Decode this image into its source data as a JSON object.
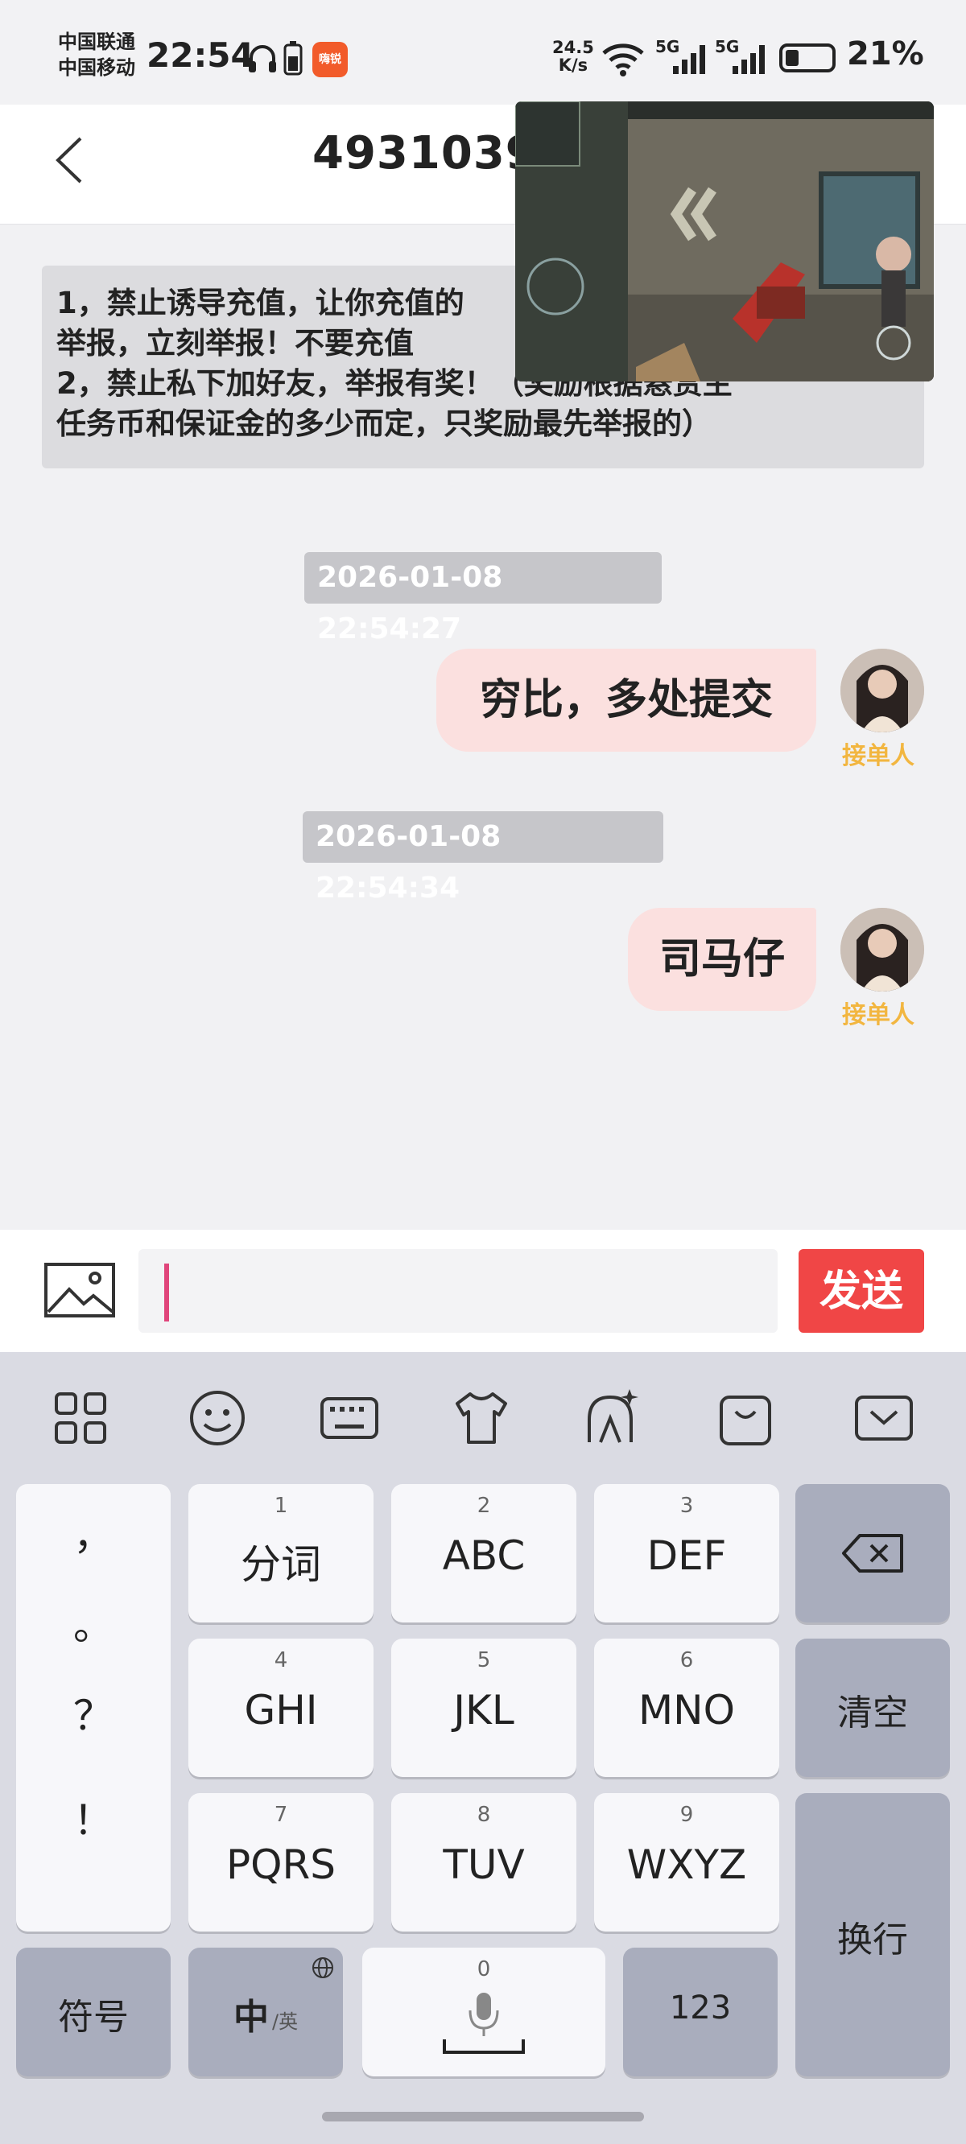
{
  "status": {
    "carrier1": "中国联通",
    "carrier2": "中国移动",
    "time": "22:54",
    "app_badge": "嗨锐",
    "net_speed": "24.5",
    "net_unit": "K/s",
    "sig1": "5G",
    "sig2": "5G",
    "battery": "21%",
    "battery_level": 0.21
  },
  "header": {
    "title": "49310391"
  },
  "notice": {
    "line1": "1，禁止诱导充值，让你充值的",
    "line2": "举报，立刻举报！不要充值",
    "line3": "2，禁止私下加好友，举报有奖！（奖励根据悬赏主",
    "line4": "任务币和保证金的多少而定，只奖励最先举报的）"
  },
  "messages": [
    {
      "time": "2026-01-08 22:54:27",
      "text": "穷比，多处提交",
      "role": "接单人"
    },
    {
      "time": "2026-01-08 22:54:34",
      "text": "司马仔",
      "role": "接单人"
    }
  ],
  "input": {
    "value": "",
    "send_label": "发送"
  },
  "keyboard": {
    "punct": [
      "，",
      "。",
      "？",
      "！"
    ],
    "keys": [
      {
        "num": "1",
        "label": "分词"
      },
      {
        "num": "2",
        "label": "ABC"
      },
      {
        "num": "3",
        "label": "DEF"
      },
      {
        "num": "4",
        "label": "GHI"
      },
      {
        "num": "5",
        "label": "JKL"
      },
      {
        "num": "6",
        "label": "MNO"
      },
      {
        "num": "7",
        "label": "PQRS"
      },
      {
        "num": "8",
        "label": "TUV"
      },
      {
        "num": "9",
        "label": "WXYZ"
      }
    ],
    "clear": "清空",
    "enter": "换行",
    "symbol": "符号",
    "lang_main": "中",
    "lang_sub": "/英",
    "space_num": "0",
    "num_mode": "123"
  },
  "colors": {
    "send": "#f04646",
    "bubble": "#fbe0df",
    "role": "#f2b640",
    "caret": "#e0457b"
  }
}
